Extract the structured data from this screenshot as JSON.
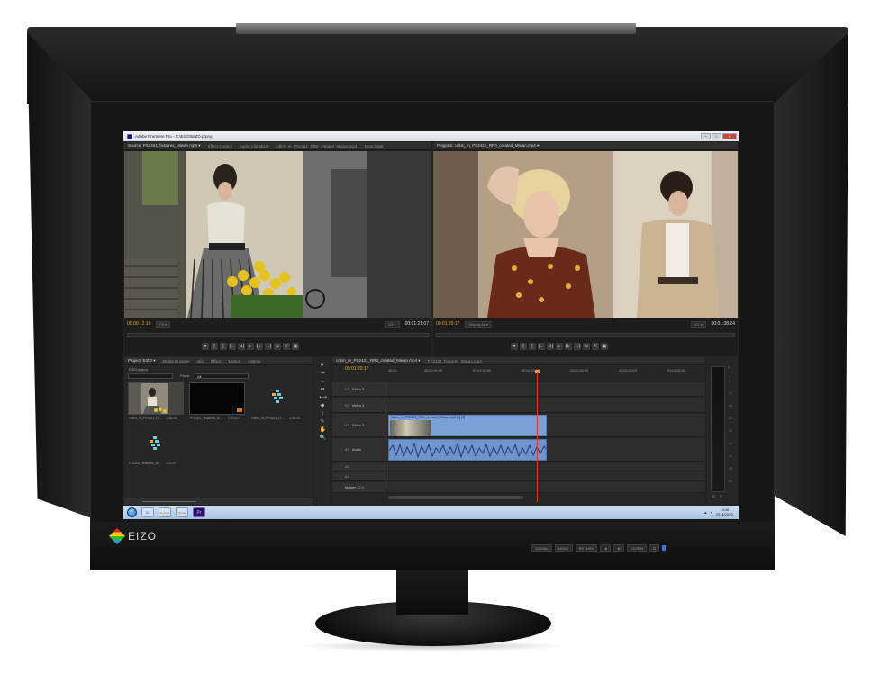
{
  "monitor": {
    "brand": "EIZO",
    "front_buttons": [
      "SIGNAL",
      "MODE",
      "RETURN",
      "◄",
      "►",
      "ENTER",
      "⏻"
    ]
  },
  "window": {
    "title": "Adobe Premiere Pro - C:\\EIZO\\EIZO.prproj",
    "controls": [
      "─",
      "□",
      "✕"
    ]
  },
  "source_monitor": {
    "tabs": [
      "Source: PS2421_features_Miwan.mp4 ▾",
      "Effect Control",
      "Audio Clip Mixer",
      "cdkm_m_PS2421_RR0_created_Miwan.mp4",
      "Meta Data"
    ],
    "timecode_in": "00:00:12:10",
    "fit_label": "Fit ▾",
    "scale_label": "1/2 ▾",
    "timecode_out": "00:01:21:07"
  },
  "program_monitor": {
    "tabs": [
      "Program: cdkm_m_PS2421_RR0_created_Miwan.mp4 ▾"
    ],
    "timecode_in": "00:01:20:17",
    "display_label": "Display All ▾",
    "scale_label": "1/2 ▾",
    "timecode_out": "00:01:38:24"
  },
  "transport_icons": [
    "▼",
    "{",
    "}",
    "|←",
    "◄|",
    "►",
    "|►",
    "→|",
    "⇲",
    "⇱",
    "▣"
  ],
  "project_panel": {
    "tabs": [
      "Project: EIZO ▾",
      "Media Browser",
      "Info",
      "Effect",
      "Marker",
      "History"
    ],
    "project_name": "EIZO.prproj",
    "place_label": "Place:",
    "place_value": "All",
    "items": [
      {
        "name": "cdkm_m_PS2421_R...",
        "duration": "1:38:24"
      },
      {
        "name": "PS2421_features_M...",
        "duration": "1:21:07"
      },
      {
        "name": "cdkm_m_PS2421_R...",
        "duration": "1:38:24"
      },
      {
        "name": "PS2421_features_M...",
        "duration": "1:21:07"
      }
    ]
  },
  "tools": [
    "▸",
    "⇥",
    "↔",
    "⇹",
    "⟷",
    "◆",
    "↕",
    "✎",
    "✋",
    "🔍"
  ],
  "timeline": {
    "tabs": [
      "cdkm_m_PS2421_RR0_created_Miwan.mp4 ▾",
      "PS2421_features_Miwan.mp4"
    ],
    "timecode": "00:01:20:17",
    "ruler": [
      "00:00",
      "00:00:30:00",
      "00:01:00:00",
      "00:01:30:00",
      "00:02:00:00",
      "00:02:30:00",
      "00:03:00:00"
    ],
    "tracks": [
      {
        "id": "V3",
        "name": "Video 3"
      },
      {
        "id": "V2",
        "name": "Video 2"
      },
      {
        "id": "V1",
        "name": "Video 1"
      },
      {
        "id": "A1",
        "name": "Audio"
      },
      {
        "id": "A2",
        "name": ""
      },
      {
        "id": "A3",
        "name": ""
      }
    ],
    "clip_label": "cdkm_m_PS2421_RR0_created_Miwan.mp4 [V] [3]",
    "master_label": "Master",
    "master_value": "0.0"
  },
  "meter": {
    "ticks": [
      "0",
      "-6",
      "-12",
      "-18",
      "-24",
      "-30",
      "-36",
      "-42",
      "-48",
      "-54"
    ],
    "buttons": [
      "S",
      "S"
    ]
  },
  "taskbar": {
    "apps": [
      "IE",
      "Explorer",
      "Media",
      "Pr"
    ],
    "time": "14:46",
    "date": "2014/03/02"
  },
  "colors": {
    "accent_timecode": "#e8a62c",
    "playhead": "#e0342b",
    "clip_video": "#7aa0d8",
    "clip_audio": "#6e94cc"
  }
}
